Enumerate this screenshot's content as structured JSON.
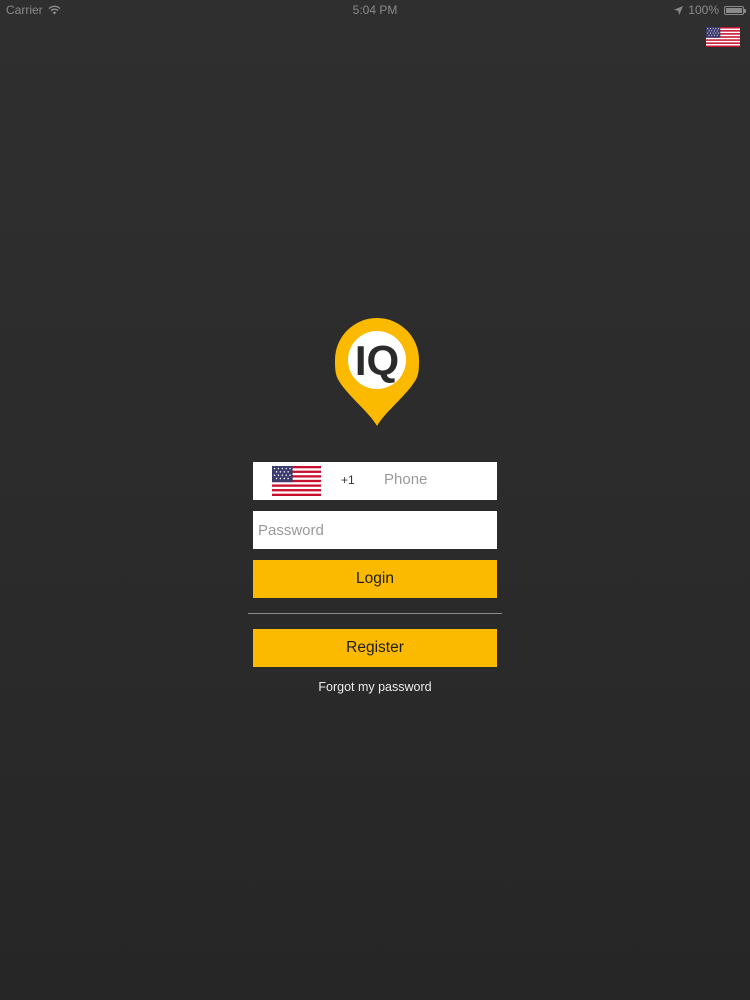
{
  "status_bar": {
    "carrier": "Carrier",
    "time": "5:04 PM",
    "battery": "100%",
    "battery_level": 1.0,
    "icons": [
      "wifi-icon",
      "location-arrow-icon",
      "battery-icon"
    ]
  },
  "header": {
    "language_flag": "us-flag-icon"
  },
  "logo": {
    "text": "IQ",
    "color": "#fbba00"
  },
  "form": {
    "phone": {
      "country_flag": "us-flag-icon",
      "country_code": "+1",
      "placeholder": "Phone",
      "value": ""
    },
    "password": {
      "placeholder": "Password",
      "value": ""
    },
    "login_label": "Login",
    "register_label": "Register",
    "forgot_label": "Forgot my password"
  },
  "colors": {
    "background": "#2b2b2b",
    "accent": "#fbba00",
    "field_background": "#ffffff",
    "divider": "#8b8b8b"
  }
}
